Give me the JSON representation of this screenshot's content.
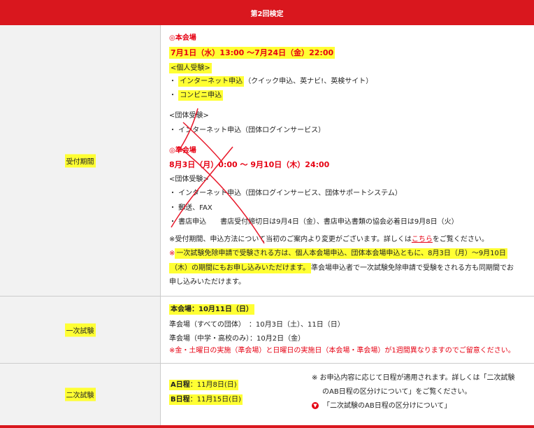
{
  "header": {
    "title": "第2回検定"
  },
  "reception": {
    "label": "受付期間",
    "main_venue": {
      "heading": "◎本会場",
      "period": "7月1日（水）13:00 ～7月24日（金）22:00",
      "individual_heading": "<個人受験>",
      "individual_items": [
        {
          "bullet": "・",
          "highlight": "インターネット申込",
          "rest": "（クイック申込、英ナビ!、英検サイト）"
        },
        {
          "bullet": "・",
          "highlight": "コンビニ申込",
          "rest": ""
        }
      ],
      "group_heading": "<団体受験>",
      "group_items": [
        "・ インターネット申込（団体ログインサービス）"
      ]
    },
    "sub_venue": {
      "heading": "◎準会場",
      "period": "8月3日（月）0:00 ～ 9月10日（木）24:00",
      "group_heading": "<団体受験>",
      "items": [
        "・ インターネット申込（団体ログインサービス、団体サポートシステム）",
        "・ 郵送、FAX",
        "・ 書店申込　　書店受付締切日は9月4日（金）、書店申込書類の協会必着日は9月8日（火）"
      ]
    },
    "notes": {
      "note1_before": "※受付期間、申込方法について当初のご案内より変更がございます。詳しくは",
      "note1_link": "こちら",
      "note1_after": "をご覧ください。",
      "note2_prefix": "※",
      "note2_line1": "一次試験免除申請で受験される方は、個人本会場申込、団体本会場申込ともに、8月3日（月）～9月10日",
      "note2_line2_hl": "（木）の期間にもお申し込みいただけます。",
      "note2_line2_rest": "準会場申込者で一次試験免除申請で受験をされる方も同期間でお",
      "note2_line3": "申し込みいただけます。"
    }
  },
  "first_exam": {
    "label": "一次試験",
    "main": "本会場：10月11日（日）",
    "sub_all": "準会場（すべての団体）　：10月3日（土）、11日（日）",
    "sub_school": "準会場（中学・高校のみ）：10月2日（金）",
    "warning": "※金・土曜日の実施（準会場）と日曜日の実施日（本会場・準会場）が1週間異なりますのでご留意ください。"
  },
  "second_exam": {
    "label": "二次試験",
    "a_label": "A日程",
    "a_date": "：11月8日(日)",
    "b_label": "B日程",
    "b_date": "：11月15日(日)",
    "note_line1": "※  お申込内容に応じて日程が適用されます。詳しくは「二次試験",
    "note_line2": "のAB日程の区分けについて」をご覧ください。",
    "link_icon": "chevron-down-circle-icon",
    "link_text": "「二次試験のAB日程の区分けについて」"
  },
  "colors": {
    "brand_red": "#d9171e",
    "text_red": "#e60012",
    "highlight": "#ffff33",
    "annotation_red": "#e8182a"
  }
}
